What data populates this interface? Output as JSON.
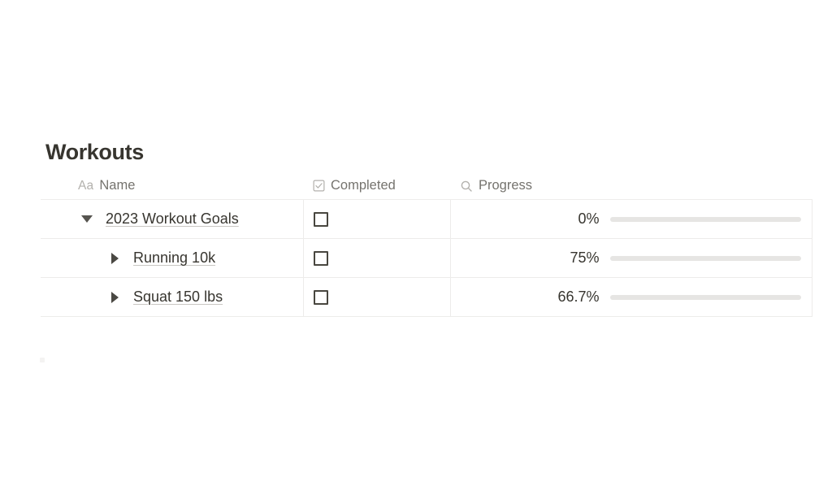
{
  "block": {
    "title": "Workouts"
  },
  "columns": [
    {
      "id": "name",
      "label": "Name",
      "icon": "text-aa-icon",
      "icon_text": "Aa"
    },
    {
      "id": "completed",
      "label": "Completed",
      "icon": "checkbox-checked-icon"
    },
    {
      "id": "progress",
      "label": "Progress",
      "icon": "search-icon"
    }
  ],
  "rows": [
    {
      "name": "2023 Workout Goals",
      "toggle": "expanded",
      "indent": 0,
      "completed": false,
      "progress_label": "0%",
      "progress_percent": 0
    },
    {
      "name": "Running 10k",
      "toggle": "collapsed",
      "indent": 1,
      "completed": false,
      "progress_label": "75%",
      "progress_percent": 75
    },
    {
      "name": "Squat 150 lbs",
      "toggle": "collapsed",
      "indent": 1,
      "completed": false,
      "progress_label": "66.7%",
      "progress_percent": 66.7
    }
  ],
  "colors": {
    "progress_fill": "#9b79c2",
    "progress_track": "#e6e5e3",
    "text": "#37352f",
    "muted_text": "#75736e"
  }
}
